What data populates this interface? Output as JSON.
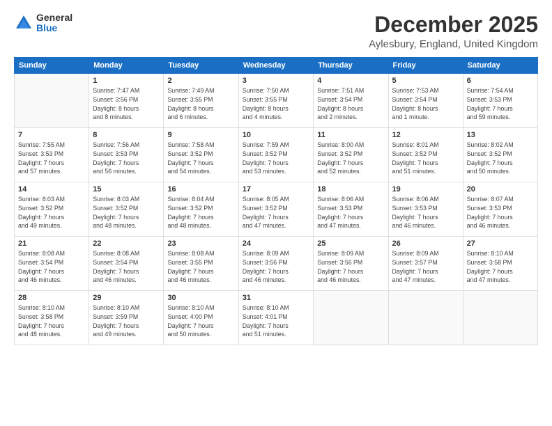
{
  "logo": {
    "general": "General",
    "blue": "Blue"
  },
  "header": {
    "title": "December 2025",
    "subtitle": "Aylesbury, England, United Kingdom"
  },
  "days_of_week": [
    "Sunday",
    "Monday",
    "Tuesday",
    "Wednesday",
    "Thursday",
    "Friday",
    "Saturday"
  ],
  "weeks": [
    [
      {
        "day": "",
        "info": ""
      },
      {
        "day": "1",
        "info": "Sunrise: 7:47 AM\nSunset: 3:56 PM\nDaylight: 8 hours\nand 8 minutes."
      },
      {
        "day": "2",
        "info": "Sunrise: 7:49 AM\nSunset: 3:55 PM\nDaylight: 8 hours\nand 6 minutes."
      },
      {
        "day": "3",
        "info": "Sunrise: 7:50 AM\nSunset: 3:55 PM\nDaylight: 8 hours\nand 4 minutes."
      },
      {
        "day": "4",
        "info": "Sunrise: 7:51 AM\nSunset: 3:54 PM\nDaylight: 8 hours\nand 2 minutes."
      },
      {
        "day": "5",
        "info": "Sunrise: 7:53 AM\nSunset: 3:54 PM\nDaylight: 8 hours\nand 1 minute."
      },
      {
        "day": "6",
        "info": "Sunrise: 7:54 AM\nSunset: 3:53 PM\nDaylight: 7 hours\nand 59 minutes."
      }
    ],
    [
      {
        "day": "7",
        "info": "Sunrise: 7:55 AM\nSunset: 3:53 PM\nDaylight: 7 hours\nand 57 minutes."
      },
      {
        "day": "8",
        "info": "Sunrise: 7:56 AM\nSunset: 3:53 PM\nDaylight: 7 hours\nand 56 minutes."
      },
      {
        "day": "9",
        "info": "Sunrise: 7:58 AM\nSunset: 3:52 PM\nDaylight: 7 hours\nand 54 minutes."
      },
      {
        "day": "10",
        "info": "Sunrise: 7:59 AM\nSunset: 3:52 PM\nDaylight: 7 hours\nand 53 minutes."
      },
      {
        "day": "11",
        "info": "Sunrise: 8:00 AM\nSunset: 3:52 PM\nDaylight: 7 hours\nand 52 minutes."
      },
      {
        "day": "12",
        "info": "Sunrise: 8:01 AM\nSunset: 3:52 PM\nDaylight: 7 hours\nand 51 minutes."
      },
      {
        "day": "13",
        "info": "Sunrise: 8:02 AM\nSunset: 3:52 PM\nDaylight: 7 hours\nand 50 minutes."
      }
    ],
    [
      {
        "day": "14",
        "info": "Sunrise: 8:03 AM\nSunset: 3:52 PM\nDaylight: 7 hours\nand 49 minutes."
      },
      {
        "day": "15",
        "info": "Sunrise: 8:03 AM\nSunset: 3:52 PM\nDaylight: 7 hours\nand 48 minutes."
      },
      {
        "day": "16",
        "info": "Sunrise: 8:04 AM\nSunset: 3:52 PM\nDaylight: 7 hours\nand 48 minutes."
      },
      {
        "day": "17",
        "info": "Sunrise: 8:05 AM\nSunset: 3:52 PM\nDaylight: 7 hours\nand 47 minutes."
      },
      {
        "day": "18",
        "info": "Sunrise: 8:06 AM\nSunset: 3:53 PM\nDaylight: 7 hours\nand 47 minutes."
      },
      {
        "day": "19",
        "info": "Sunrise: 8:06 AM\nSunset: 3:53 PM\nDaylight: 7 hours\nand 46 minutes."
      },
      {
        "day": "20",
        "info": "Sunrise: 8:07 AM\nSunset: 3:53 PM\nDaylight: 7 hours\nand 46 minutes."
      }
    ],
    [
      {
        "day": "21",
        "info": "Sunrise: 8:08 AM\nSunset: 3:54 PM\nDaylight: 7 hours\nand 46 minutes."
      },
      {
        "day": "22",
        "info": "Sunrise: 8:08 AM\nSunset: 3:54 PM\nDaylight: 7 hours\nand 46 minutes."
      },
      {
        "day": "23",
        "info": "Sunrise: 8:08 AM\nSunset: 3:55 PM\nDaylight: 7 hours\nand 46 minutes."
      },
      {
        "day": "24",
        "info": "Sunrise: 8:09 AM\nSunset: 3:56 PM\nDaylight: 7 hours\nand 46 minutes."
      },
      {
        "day": "25",
        "info": "Sunrise: 8:09 AM\nSunset: 3:56 PM\nDaylight: 7 hours\nand 46 minutes."
      },
      {
        "day": "26",
        "info": "Sunrise: 8:09 AM\nSunset: 3:57 PM\nDaylight: 7 hours\nand 47 minutes."
      },
      {
        "day": "27",
        "info": "Sunrise: 8:10 AM\nSunset: 3:58 PM\nDaylight: 7 hours\nand 47 minutes."
      }
    ],
    [
      {
        "day": "28",
        "info": "Sunrise: 8:10 AM\nSunset: 3:58 PM\nDaylight: 7 hours\nand 48 minutes."
      },
      {
        "day": "29",
        "info": "Sunrise: 8:10 AM\nSunset: 3:59 PM\nDaylight: 7 hours\nand 49 minutes."
      },
      {
        "day": "30",
        "info": "Sunrise: 8:10 AM\nSunset: 4:00 PM\nDaylight: 7 hours\nand 50 minutes."
      },
      {
        "day": "31",
        "info": "Sunrise: 8:10 AM\nSunset: 4:01 PM\nDaylight: 7 hours\nand 51 minutes."
      },
      {
        "day": "",
        "info": ""
      },
      {
        "day": "",
        "info": ""
      },
      {
        "day": "",
        "info": ""
      }
    ]
  ]
}
